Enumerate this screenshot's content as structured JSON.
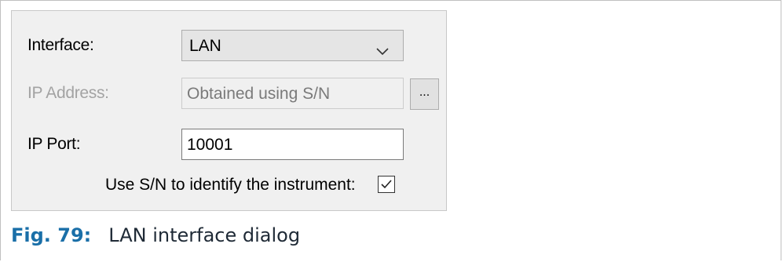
{
  "dialog": {
    "interface": {
      "label": "Interface:",
      "selected": "LAN"
    },
    "ip_address": {
      "label": "IP Address:",
      "value": "Obtained using S/N",
      "browse_label": "..."
    },
    "ip_port": {
      "label": "IP Port:",
      "value": "10001"
    },
    "use_sn": {
      "label": "Use S/N to identify the instrument:",
      "checked": true
    }
  },
  "caption": {
    "number": "Fig. 79:",
    "text": "LAN interface dialog"
  },
  "colors": {
    "caption_accent": "#1a6fa8",
    "dialog_bg": "#f0f0f0",
    "disabled_text": "#a3a3a3"
  },
  "icons": {
    "dropdown": "chevron-down-icon",
    "checkbox": "check-icon"
  }
}
